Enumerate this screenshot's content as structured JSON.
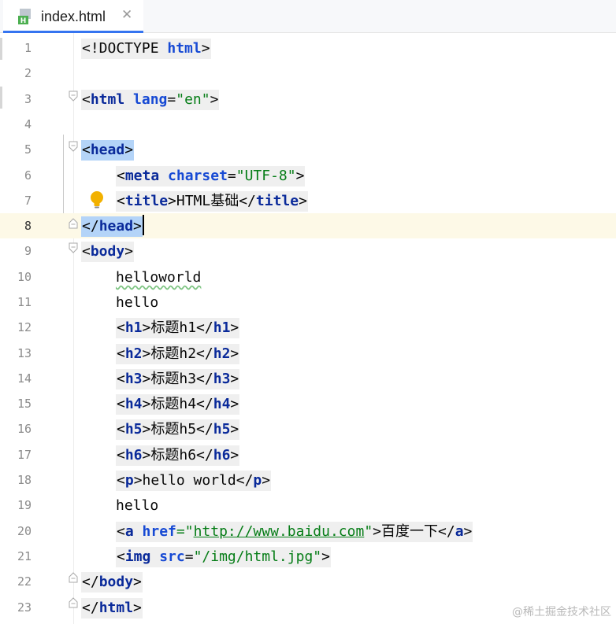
{
  "tab": {
    "file_name": "index.html",
    "close_glyph": "✕",
    "icon_letter": "H"
  },
  "editor": {
    "current_line": 8,
    "lines": [
      {
        "n": "1",
        "parts": [
          {
            "t": "<!DOCTYPE ",
            "c": ""
          },
          {
            "t": "html",
            "c": "attr"
          },
          {
            "t": ">",
            "c": ""
          }
        ]
      },
      {
        "n": "2",
        "parts": []
      },
      {
        "n": "3",
        "parts": [
          {
            "t": "<",
            "c": ""
          },
          {
            "t": "html",
            "c": "tag"
          },
          {
            "t": " ",
            "c": ""
          },
          {
            "t": "lang",
            "c": "attr"
          },
          {
            "t": "=",
            "c": ""
          },
          {
            "t": "\"en\"",
            "c": "str"
          },
          {
            "t": ">",
            "c": ""
          }
        ]
      },
      {
        "n": "4",
        "parts": []
      },
      {
        "n": "5",
        "parts": [
          {
            "t": "<",
            "c": ""
          },
          {
            "t": "head",
            "c": "tag"
          },
          {
            "t": ">",
            "c": ""
          }
        ]
      },
      {
        "n": "6",
        "parts": [
          {
            "t": "<",
            "c": ""
          },
          {
            "t": "meta",
            "c": "tag"
          },
          {
            "t": " ",
            "c": ""
          },
          {
            "t": "charset",
            "c": "attr"
          },
          {
            "t": "=",
            "c": ""
          },
          {
            "t": "\"UTF-8\"",
            "c": "str"
          },
          {
            "t": ">",
            "c": ""
          }
        ]
      },
      {
        "n": "7",
        "parts": [
          {
            "t": "<",
            "c": ""
          },
          {
            "t": "title",
            "c": "tag"
          },
          {
            "t": ">HTML",
            "c": ""
          },
          {
            "t": "基础",
            "c": "cjk"
          },
          {
            "t": "</",
            "c": ""
          },
          {
            "t": "title",
            "c": "tag"
          },
          {
            "t": ">",
            "c": ""
          }
        ]
      },
      {
        "n": "8",
        "parts": [
          {
            "t": "</",
            "c": ""
          },
          {
            "t": "head",
            "c": "tag"
          },
          {
            "t": ">",
            "c": ""
          }
        ]
      },
      {
        "n": "9",
        "parts": [
          {
            "t": "<",
            "c": ""
          },
          {
            "t": "body",
            "c": "tag"
          },
          {
            "t": ">",
            "c": ""
          }
        ]
      },
      {
        "n": "10",
        "parts": [
          {
            "t": "helloworld",
            "c": "typo"
          }
        ]
      },
      {
        "n": "11",
        "parts": [
          {
            "t": "hello",
            "c": ""
          }
        ]
      },
      {
        "n": "12",
        "parts": [
          {
            "t": "<",
            "c": ""
          },
          {
            "t": "h1",
            "c": "tag"
          },
          {
            "t": ">",
            "c": ""
          },
          {
            "t": "标题",
            "c": "cjk"
          },
          {
            "t": "h1</",
            "c": ""
          },
          {
            "t": "h1",
            "c": "tag"
          },
          {
            "t": ">",
            "c": ""
          }
        ]
      },
      {
        "n": "13",
        "parts": [
          {
            "t": "<",
            "c": ""
          },
          {
            "t": "h2",
            "c": "tag"
          },
          {
            "t": ">",
            "c": ""
          },
          {
            "t": "标题",
            "c": "cjk"
          },
          {
            "t": "h2</",
            "c": ""
          },
          {
            "t": "h2",
            "c": "tag"
          },
          {
            "t": ">",
            "c": ""
          }
        ]
      },
      {
        "n": "14",
        "parts": [
          {
            "t": "<",
            "c": ""
          },
          {
            "t": "h3",
            "c": "tag"
          },
          {
            "t": ">",
            "c": ""
          },
          {
            "t": "标题",
            "c": "cjk"
          },
          {
            "t": "h3</",
            "c": ""
          },
          {
            "t": "h3",
            "c": "tag"
          },
          {
            "t": ">",
            "c": ""
          }
        ]
      },
      {
        "n": "15",
        "parts": [
          {
            "t": "<",
            "c": ""
          },
          {
            "t": "h4",
            "c": "tag"
          },
          {
            "t": ">",
            "c": ""
          },
          {
            "t": "标题",
            "c": "cjk"
          },
          {
            "t": "h4</",
            "c": ""
          },
          {
            "t": "h4",
            "c": "tag"
          },
          {
            "t": ">",
            "c": ""
          }
        ]
      },
      {
        "n": "16",
        "parts": [
          {
            "t": "<",
            "c": ""
          },
          {
            "t": "h5",
            "c": "tag"
          },
          {
            "t": ">",
            "c": ""
          },
          {
            "t": "标题",
            "c": "cjk"
          },
          {
            "t": "h5</",
            "c": ""
          },
          {
            "t": "h5",
            "c": "tag"
          },
          {
            "t": ">",
            "c": ""
          }
        ]
      },
      {
        "n": "17",
        "parts": [
          {
            "t": "<",
            "c": ""
          },
          {
            "t": "h6",
            "c": "tag"
          },
          {
            "t": ">",
            "c": ""
          },
          {
            "t": "标题",
            "c": "cjk"
          },
          {
            "t": "h6</",
            "c": ""
          },
          {
            "t": "h6",
            "c": "tag"
          },
          {
            "t": ">",
            "c": ""
          }
        ]
      },
      {
        "n": "18",
        "parts": [
          {
            "t": "<",
            "c": ""
          },
          {
            "t": "p",
            "c": "tag"
          },
          {
            "t": ">hello world</",
            "c": ""
          },
          {
            "t": "p",
            "c": "tag"
          },
          {
            "t": ">",
            "c": ""
          }
        ]
      },
      {
        "n": "19",
        "parts": [
          {
            "t": "hello",
            "c": ""
          }
        ]
      },
      {
        "n": "20",
        "parts": [
          {
            "t": "<",
            "c": ""
          },
          {
            "t": "a",
            "c": "tag"
          },
          {
            "t": " ",
            "c": ""
          },
          {
            "t": "href",
            "c": "attr"
          },
          {
            "t": "=\"",
            "c": "str"
          },
          {
            "t": "http://www.baidu.com",
            "c": "url"
          },
          {
            "t": "\"",
            "c": "str"
          },
          {
            "t": ">",
            "c": ""
          },
          {
            "t": "百度一下",
            "c": "cjk"
          },
          {
            "t": "</",
            "c": ""
          },
          {
            "t": "a",
            "c": "tag"
          },
          {
            "t": ">",
            "c": ""
          }
        ]
      },
      {
        "n": "21",
        "parts": [
          {
            "t": "<",
            "c": ""
          },
          {
            "t": "img",
            "c": "tag"
          },
          {
            "t": " ",
            "c": ""
          },
          {
            "t": "src",
            "c": "attr"
          },
          {
            "t": "=",
            "c": ""
          },
          {
            "t": "\"/img/html.jpg\"",
            "c": "str"
          },
          {
            "t": ">",
            "c": ""
          }
        ]
      },
      {
        "n": "22",
        "parts": [
          {
            "t": "</",
            "c": ""
          },
          {
            "t": "body",
            "c": "tag"
          },
          {
            "t": ">",
            "c": ""
          }
        ]
      },
      {
        "n": "23",
        "parts": [
          {
            "t": "</",
            "c": ""
          },
          {
            "t": "html",
            "c": "tag"
          },
          {
            "t": ">",
            "c": ""
          }
        ]
      }
    ]
  },
  "icons": {
    "file": "html-file-icon",
    "close": "close-icon",
    "bulb": "lightbulb-icon",
    "fold": "fold-marker-icon"
  },
  "colors": {
    "tag": "#0a2a9a",
    "attr": "#174ad4",
    "string": "#067d17",
    "current_line_bg": "#fdf9e7",
    "selection": "#b4d4f8",
    "accent": "#3574f0"
  },
  "watermark": "@稀土掘金技术社区"
}
